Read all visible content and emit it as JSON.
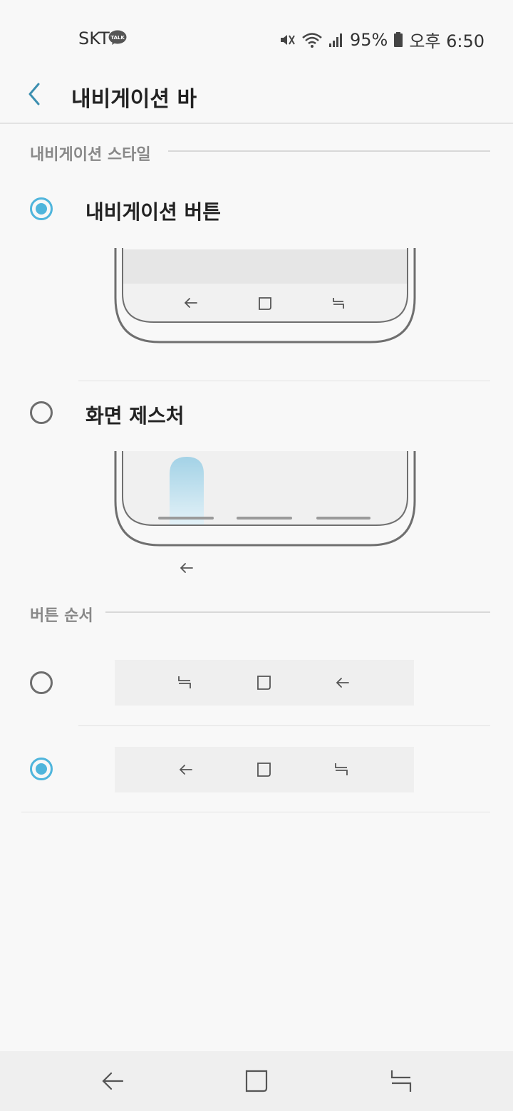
{
  "status_bar": {
    "carrier": "SKT",
    "talk_badge": "TALK",
    "battery": "95%",
    "time": "오후 6:50",
    "icons": [
      "kakaotalk-icon",
      "mute-icon",
      "wifi-icon",
      "signal-icon",
      "battery-icon"
    ]
  },
  "header": {
    "title": "내비게이션 바",
    "back_icon": "back-chevron-icon"
  },
  "sections": {
    "style_header": "내비게이션 스타일",
    "order_header": "버튼 순서"
  },
  "style_options": [
    {
      "label": "내비게이션 버튼",
      "selected": true
    },
    {
      "label": "화면 제스처",
      "selected": false
    }
  ],
  "order_options": [
    {
      "buttons": [
        "recent-apps-icon",
        "home-icon",
        "back-icon"
      ],
      "selected": false
    },
    {
      "buttons": [
        "back-icon",
        "home-icon",
        "recent-apps-icon"
      ],
      "selected": true
    }
  ],
  "colors": {
    "accent": "#4fb5dc",
    "background": "#f8f8f8",
    "nav_bar": "#efefef"
  }
}
